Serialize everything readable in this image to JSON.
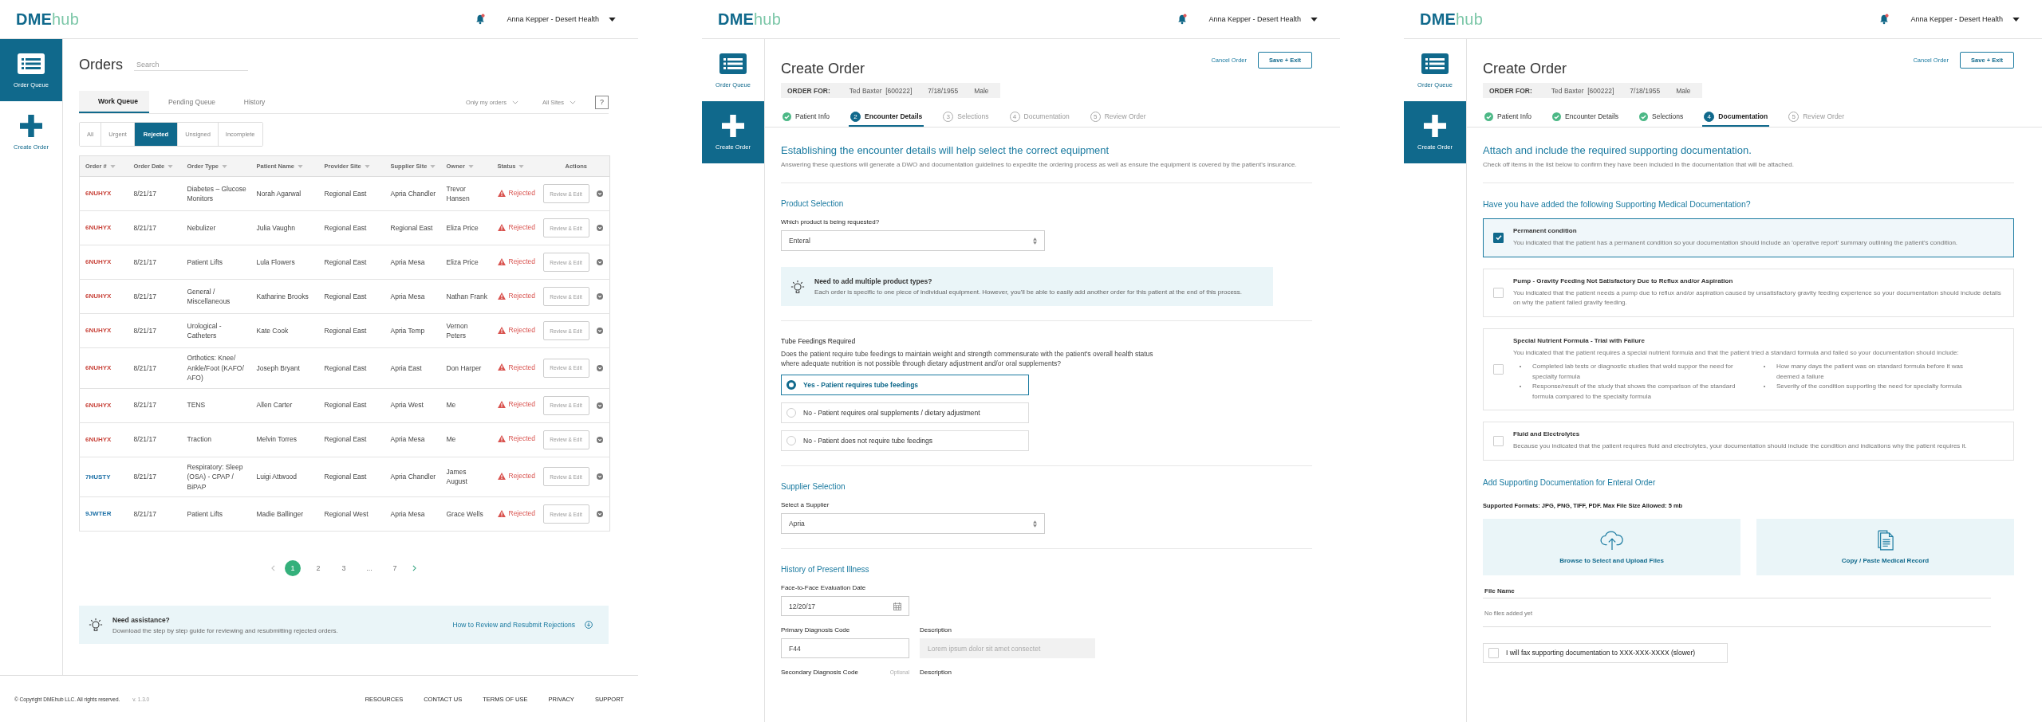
{
  "screens": [
    {
      "kind": "orders",
      "header": {
        "logo": "**DME**hub",
        "user": "Anna Kepper - Desert Health"
      },
      "sidebar": [
        {
          "label": "Order Queue",
          "selected": true
        },
        {
          "label": "Create Order",
          "selected": false
        }
      ],
      "title": "Orders",
      "search": {
        "placeholder": "Search"
      },
      "tabs": [
        {
          "label": "Work Queue",
          "selected": true
        },
        {
          "label": "Pending Queue",
          "selected": false
        },
        {
          "label": "History",
          "selected": false
        }
      ],
      "dropdowns": [
        "Only my orders",
        "All Sites"
      ],
      "help": "?",
      "filters": [
        {
          "label": "All",
          "selected": false
        },
        {
          "label": "Urgent",
          "selected": false
        },
        {
          "label": "Rejected",
          "selected": true
        },
        {
          "label": "Unsigned",
          "selected": false
        },
        {
          "label": "Incomplete",
          "selected": false
        }
      ],
      "table": {
        "columns": [
          "Order #",
          "Order Date",
          "Order Type",
          "Patient Name",
          "Provider Site",
          "Supplier Site",
          "Owner",
          "Status",
          "Actions"
        ],
        "rows": [
          {
            "order": "6NUHYX",
            "color": "#c9463d",
            "date": "8/21/17",
            "type": "Diabetes – Glucose Monitors",
            "patient": "Norah Agarwal",
            "provider": "Regional East",
            "supplier": "Apria Chandler",
            "owner": "Trevor Hansen",
            "status": "Rejected",
            "action": "Review & Edit"
          },
          {
            "order": "6NUHYX",
            "color": "#c9463d",
            "date": "8/21/17",
            "type": "Nebulizer",
            "patient": "Julia Vaughn",
            "provider": "Regional East",
            "supplier": "Regional East",
            "owner": "Eliza Price",
            "status": "Rejected",
            "action": "Review & Edit"
          },
          {
            "order": "6NUHYX",
            "color": "#c9463d",
            "date": "8/21/17",
            "type": "Patient Lifts",
            "patient": "Lula Flowers",
            "provider": "Regional East",
            "supplier": "Apria Mesa",
            "owner": "Eliza Price",
            "status": "Rejected",
            "action": "Review & Edit"
          },
          {
            "order": "6NUHYX",
            "color": "#c9463d",
            "date": "8/21/17",
            "type": "General / Miscellaneous",
            "patient": "Katharine Brooks",
            "provider": "Regional East",
            "supplier": "Apria Mesa",
            "owner": "Nathan Frank",
            "status": "Rejected",
            "action": "Review & Edit"
          },
          {
            "order": "6NUHYX",
            "color": "#c9463d",
            "date": "8/21/17",
            "type": "Urological - Catheters",
            "patient": "Kate Cook",
            "provider": "Regional East",
            "supplier": "Apria Temp",
            "owner": "Vernon Peters",
            "status": "Rejected",
            "action": "Review & Edit"
          },
          {
            "order": "6NUHYX",
            "color": "#c9463d",
            "date": "8/21/17",
            "type": "Orthotics: Knee/ Ankle/Foot (KAFO/ AFO)",
            "patient": "Joseph Bryant",
            "provider": "Regional East",
            "supplier": "Apria East",
            "owner": "Don Harper",
            "status": "Rejected",
            "action": "Review & Edit"
          },
          {
            "order": "6NUHYX",
            "color": "#c9463d",
            "date": "8/21/17",
            "type": "TENS",
            "patient": "Allen Carter",
            "provider": "Regional East",
            "supplier": "Apria West",
            "owner": "Me",
            "status": "Rejected",
            "action": "Review & Edit"
          },
          {
            "order": "6NUHYX",
            "color": "#c9463d",
            "date": "8/21/17",
            "type": "Traction",
            "patient": "Melvin Torres",
            "provider": "Regional East",
            "supplier": "Apria Mesa",
            "owner": "Me",
            "status": "Rejected",
            "action": "Review & Edit"
          },
          {
            "order": "7HUSTY",
            "color": "#1b6fa6",
            "date": "8/21/17",
            "type": "Respiratory: Sleep (OSA) - CPAP / BiPAP",
            "patient": "Luigi Attwood",
            "provider": "Regional East",
            "supplier": "Apria Chandler",
            "owner": "James August",
            "status": "Rejected",
            "action": "Review & Edit"
          },
          {
            "order": "9JWTER",
            "color": "#1b6fa6",
            "date": "8/21/17",
            "type": "Patient Lifts",
            "patient": "Madie Ballinger",
            "provider": "Regional West",
            "supplier": "Apria Mesa",
            "owner": "Grace Wells",
            "status": "Rejected",
            "action": "Review & Edit"
          }
        ]
      },
      "pages": [
        {
          "label": "1",
          "selected": true
        },
        {
          "label": "2",
          "selected": false
        },
        {
          "label": "3",
          "selected": false
        },
        {
          "label": "...",
          "selected": false
        },
        {
          "label": "7",
          "selected": false
        }
      ],
      "assist": {
        "title": "Need assistance?",
        "text": "Download the step by step guide for reviewing and resubmitting rejected orders.",
        "link": "How to Review and Resubmit Rejections"
      },
      "footer": {
        "copyright": "© Copyright DMEhub LLC. All rights reserved.",
        "version": "v. 1.3.0",
        "links": [
          "RESOURCES",
          "CONTACT US",
          "TERMS OF USE",
          "PRIVACY",
          "SUPPORT"
        ]
      }
    },
    {
      "kind": "encounter",
      "header": {
        "logo": "**DME**hub",
        "user": "Anna Kepper - Desert Health"
      },
      "sidebar": [
        {
          "label": "Order Queue",
          "selected": false
        },
        {
          "label": "Create Order",
          "selected": true
        }
      ],
      "title": "Create Order",
      "cancel": "Cancel Order",
      "save": "Save + Exit",
      "order_for": {
        "label": "ORDER FOR:",
        "name": "Ted Baxter  [600222]",
        "dob": "7/18/1955",
        "sex": "Male"
      },
      "steps": [
        {
          "label": "Patient Info",
          "done": true,
          "selected": false
        },
        {
          "number": "2",
          "label": "Encounter Details",
          "done": false,
          "selected": true
        },
        {
          "number": "3",
          "label": "Selections",
          "done": false,
          "selected": false
        },
        {
          "number": "4",
          "label": "Documentation",
          "done": false,
          "selected": false
        },
        {
          "number": "5",
          "label": "Review Order",
          "done": false,
          "selected": false
        }
      ],
      "heading": "Establishing the encounter details will help select the correct equipment",
      "intro": "Answering these questions will generate a DWO and documentation guidelines to expedite the ordering process as well as ensure the equipment is covered by the patient's insurance.",
      "product": {
        "title": "Product Selection",
        "label": "Which product is being requested?",
        "value": "Enteral"
      },
      "tip": {
        "title": "Need to add multiple product types?",
        "text": "Each order is specific to one piece of individual equipment. However, you'll be able to easily add another order for this patient at the end of this process."
      },
      "tube": {
        "title": "Tube Feedings Required",
        "text": "Does the patient require tube feedings to maintain weight and strength commensurate with the patient's overall health status where adequate nutrition is not possible through dietary adjustment and/or oral supplements?",
        "options": [
          {
            "label": "Yes - Patient requires tube feedings",
            "selected": true
          },
          {
            "label": "No - Patient requires oral supplements / dietary adjustment",
            "selected": false
          },
          {
            "label": "No - Patient does not require tube feedings",
            "selected": false
          }
        ]
      },
      "supplier": {
        "title": "Supplier Selection",
        "label": "Select a Supplier",
        "value": "Apria"
      },
      "history": {
        "title": "History of Present Illness",
        "date_label": "Face-to-Face Evaluation Date",
        "date": "12/20/17",
        "primary_label": "Primary Diagnosis Code",
        "primary": "F44",
        "description_label": "Description",
        "description_placeholder": "Lorem ipsum dolor sit amet consectet",
        "secondary_label": "Secondary Diagnosis Code",
        "optional": "Optional",
        "secondary_description_label": "Description"
      }
    },
    {
      "kind": "documentation",
      "header": {
        "logo": "**DME**hub",
        "user": "Anna Kepper - Desert Health"
      },
      "sidebar": [
        {
          "label": "Order Queue",
          "selected": false
        },
        {
          "label": "Create Order",
          "selected": true
        }
      ],
      "title": "Create Order",
      "cancel": "Cancel Order",
      "save": "Save + Exit",
      "order_for": {
        "label": "ORDER FOR:",
        "name": "Ted Baxter  [600222]",
        "dob": "7/18/1955",
        "sex": "Male"
      },
      "steps": [
        {
          "label": "Patient Info",
          "done": true,
          "selected": false
        },
        {
          "label": "Encounter Details",
          "done": true,
          "selected": false
        },
        {
          "label": "Selections",
          "done": true,
          "selected": false
        },
        {
          "number": "4",
          "label": "Documentation",
          "done": false,
          "selected": true
        },
        {
          "number": "5",
          "label": "Review Order",
          "done": false,
          "selected": false
        }
      ],
      "heading": "Attach and include the required supporting documentation.",
      "intro": "Check off items in the list below to confirm they have been included in the documentation that will be attached.",
      "question": "Have you have added the following Supporting Medical Documentation?",
      "items": [
        {
          "title": "Permanent condition",
          "text": "You indicated that the patient has a permanent condition so your documentation should include an 'operative report' summary outlining the patient's condition.",
          "checked": true
        },
        {
          "title": "Pump - Gravity Feeding Not Satisfactory Due to Reflux and/or Aspiration",
          "text": "You indicated that the patient needs a pump due to reflux and/or aspiration caused by unsatisfactory gravity feeding experience so your documentation should include details on why the patient failed gravity feeding.",
          "checked": false
        },
        {
          "title": "Special Nutrient Formula - Trial with Failure",
          "text": "You indicated that the patient requires a special nutrient formula and that the patient tried a standard formula and failed so your documentation should include:",
          "checked": false,
          "bullets": [
            "Completed lab tests or diagnostic studies that wold suppor the need for specialty formula",
            "How many days the patient was on standard formula before it was deemed a failure",
            "Response/result of the study that shows the comparison of the standard formula compared to the specialty formula",
            "Severity of the condition supporting the need for specialty formula"
          ]
        },
        {
          "title": "Fluid and Electrolytes",
          "text": "Because you indicated that the patient requires fluid and electrolytes, your documentation should include the condition and indications why the patient requires it.",
          "checked": false
        }
      ],
      "upload": {
        "title": "Add Supporting Documentation for Enteral Order",
        "formats": "Supported Formats: JPG, PNG, TIFF, PDF.  Max File Size Allowed: 5 mb",
        "browse": "Browse to Select and Upload Files",
        "paste": "Copy / Paste Medical Record",
        "column": "File Name",
        "empty": "No files added yet"
      },
      "fax": {
        "label": "I will fax supporting documentation to XXX-XXX-XXXX (slower)",
        "checked": false
      }
    }
  ]
}
